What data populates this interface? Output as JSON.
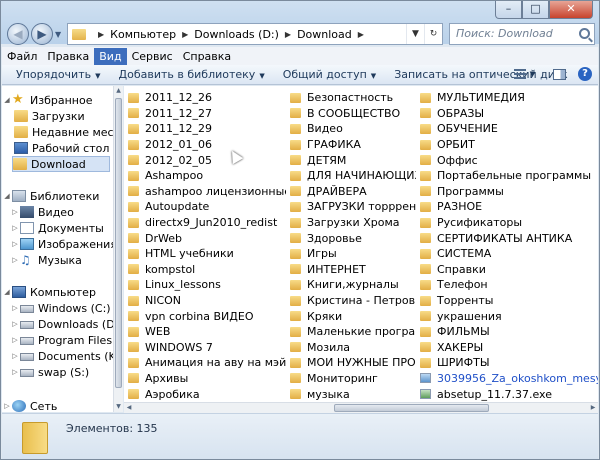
{
  "address": {
    "crumbs": [
      "Компьютер",
      "Downloads (D:)",
      "Download"
    ],
    "search_placeholder": "Поиск: Download"
  },
  "window_controls": {
    "minimize": "–",
    "maximize": "□",
    "close": "✕"
  },
  "menu": [
    "Файл",
    "Правка",
    "Вид",
    "Сервис",
    "Справка"
  ],
  "menu_active": "Вид",
  "toolbar": {
    "organize": "Упорядочить",
    "add_to_library": "Добавить в библиотеку",
    "share": "Общий доступ",
    "burn": "Записать на оптический диск"
  },
  "nav": {
    "favorites": "Избранное",
    "favorites_items": [
      "Загрузки",
      "Недавние места",
      "Рабочий стол",
      "Download"
    ],
    "libraries": "Библиотеки",
    "libraries_items": [
      "Видео",
      "Документы",
      "Изображения",
      "Музыка"
    ],
    "computer": "Компьютер",
    "computer_items": [
      "Windows (C:)",
      "Downloads (D:)",
      "Program Files (E:)",
      "Documents (K:)",
      "swap (S:)"
    ],
    "network": "Сеть"
  },
  "files": {
    "col1": [
      "2011_12_26",
      "2011_12_27",
      "2011_12_29",
      "2012_01_06",
      "2012_02_05",
      "Ashampoo",
      "ashampoo лицензионные",
      "Autoupdate",
      "directx9_Jun2010_redist",
      "DrWeb",
      "HTML учебники",
      "kompstol",
      "Linux_lessons",
      "NICON",
      "vpn corbina ВИДЕО",
      "WEB",
      "WINDOWS 7",
      "Анимация на аву на мэйл.ру",
      "Архивы",
      "Аэробика"
    ],
    "col2": [
      "Безопастность",
      "В СООБЩЕСТВО",
      "Видео",
      "ГРАФИКА",
      "ДЕТЯМ",
      "ДЛЯ НАЧИНАЮЩИХ",
      "ДРАЙВЕРА",
      "ЗАГРУЗКИ торррент",
      "Загрузки Хрома",
      "Здоровье",
      "Игры",
      "ИНТЕРНЕТ",
      "Книги,журналы",
      "Кристина - Петров",
      "Кряки",
      "Маленькие програмки",
      "Мозила",
      "МОИ НУЖНЫЕ ПРОГИ",
      "Мониторинг",
      "музыка"
    ],
    "col3": [
      "МУЛЬТИМЕДИЯ",
      "ОБРАЗЫ",
      "ОБУЧЕНИЕ",
      "ОРБИТ",
      "Оффис",
      "Портабельные программы",
      "Программы",
      "РАЗНОЕ",
      "Русификаторы",
      "СЕРТИФИКАТЫ АНТИКА",
      "СИСТЕМА",
      "Справки",
      "Телефон",
      "Торренты",
      "украшения",
      "ФИЛЬМЫ",
      "ХАКЕРЫ",
      "ШРИФТЫ",
      "3039956_Za_okoshkom_mesyac.mp3",
      "absetup_11.7.37.exe"
    ]
  },
  "status": {
    "count_text": "Элементов: 135"
  }
}
